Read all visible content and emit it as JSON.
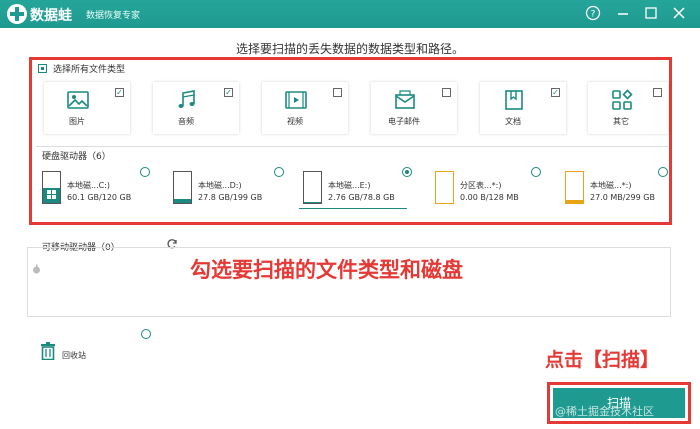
{
  "window": {
    "app_name": "数据蛙",
    "app_subtitle": "数据恢复专家",
    "help_icon": "help-circle-icon",
    "minimize_icon": "minimize-icon",
    "maximize_icon": "maximize-icon",
    "close_icon": "close-icon"
  },
  "prompt": "选择要扫描的丢失数据的数据类型和路径。",
  "file_types": {
    "select_all_label": "选择所有文件类型",
    "items": [
      {
        "label": "图片",
        "icon": "image-icon",
        "checked": true
      },
      {
        "label": "音频",
        "icon": "music-icon",
        "checked": true
      },
      {
        "label": "视频",
        "icon": "video-icon",
        "checked": false
      },
      {
        "label": "电子邮件",
        "icon": "mail-icon",
        "checked": false
      },
      {
        "label": "文档",
        "icon": "document-icon",
        "checked": true
      },
      {
        "label": "其它",
        "icon": "other-icon",
        "checked": false
      }
    ]
  },
  "hard_drives": {
    "label": "硬盘驱动器（6）",
    "items": [
      {
        "name": "本地磁...C:)",
        "size": "60.1 GB/120 GB",
        "fill": 0.5,
        "selected": false
      },
      {
        "name": "本地磁...D:)",
        "size": "27.8 GB/199 GB",
        "fill": 0.14,
        "selected": false
      },
      {
        "name": "本地磁...E:)",
        "size": "2.76 GB/78.8 GB",
        "fill": 0.04,
        "selected": true
      },
      {
        "name": "分区表...*:)",
        "size": "0.00  B/128 MB",
        "fill": 0.0,
        "selected": false
      },
      {
        "name": "本地磁...*:)",
        "size": "27.0 MB/299 GB",
        "fill": 0.09,
        "selected": false
      }
    ]
  },
  "removable": {
    "label": "可移动驱动器（0）",
    "refresh_icon": "refresh-icon"
  },
  "recycle_bin": {
    "label": "回收站",
    "icon": "trash-icon"
  },
  "annotations": {
    "main": "勾选要扫描的文件类型和磁盘",
    "scan_hint": "点击【扫描】"
  },
  "scan_button": "扫描",
  "watermark": "@稀土掘金技术社区",
  "colors": {
    "accent": "#1f9a90",
    "annotation_red": "#e53935"
  }
}
